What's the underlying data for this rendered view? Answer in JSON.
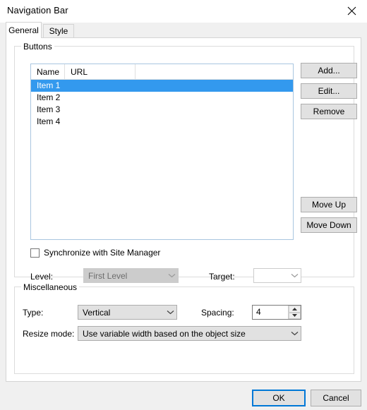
{
  "window": {
    "title": "Navigation Bar",
    "close_icon": "close-icon"
  },
  "tabs": [
    {
      "label": "General",
      "selected": true
    },
    {
      "label": "Style",
      "selected": false
    }
  ],
  "groups": {
    "buttons": {
      "legend": "Buttons",
      "list": {
        "columns": [
          "Name",
          "URL"
        ],
        "rows": [
          {
            "name": "Item 1",
            "url": "",
            "selected": true
          },
          {
            "name": "Item 2",
            "url": "",
            "selected": false
          },
          {
            "name": "Item 3",
            "url": "",
            "selected": false
          },
          {
            "name": "Item 4",
            "url": "",
            "selected": false
          }
        ]
      },
      "actions": {
        "add": "Add...",
        "edit": "Edit...",
        "remove": "Remove",
        "move_up": "Move Up",
        "move_down": "Move Down"
      },
      "sync_checkbox": {
        "label": "Synchronize with Site Manager",
        "checked": false
      },
      "level": {
        "label": "Level:",
        "value": "First Level",
        "disabled": true
      },
      "target": {
        "label": "Target:",
        "value": "",
        "disabled": false
      }
    },
    "miscellaneous": {
      "legend": "Miscellaneous",
      "type": {
        "label": "Type:",
        "value": "Vertical"
      },
      "spacing": {
        "label": "Spacing:",
        "value": "4"
      },
      "resize_mode": {
        "label": "Resize mode:",
        "value": "Use variable width based on the object size"
      }
    }
  },
  "footer": {
    "ok": "OK",
    "cancel": "Cancel"
  },
  "colors": {
    "selection_blue": "#3399ee",
    "focus_blue": "#0078d7",
    "dialog_bg": "#f0f0f0",
    "panel_bg": "#ffffff"
  }
}
